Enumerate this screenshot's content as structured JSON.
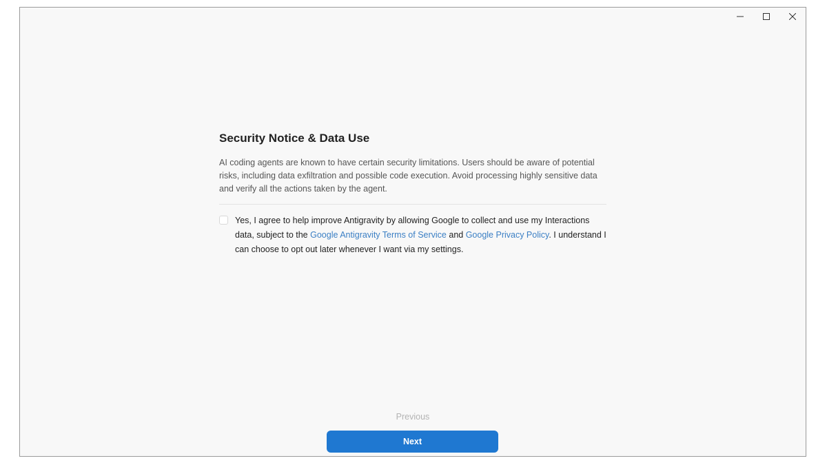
{
  "window": {
    "controls": {
      "minimize_icon": "minimize-icon",
      "maximize_icon": "maximize-icon",
      "close_icon": "close-icon"
    }
  },
  "notice": {
    "title": "Security Notice & Data Use",
    "body": "AI coding agents are known to have certain security limitations. Users should be aware of potential risks, including data exfiltration and possible code execution. Avoid processing highly sensitive data and verify all the actions taken by the agent."
  },
  "consent": {
    "checked": false,
    "text_part1": "Yes, I agree to help improve Antigravity by allowing Google to collect and use my Interactions data, subject to the ",
    "terms_link": "Google Antigravity Terms of Service",
    "text_part2": " and ",
    "privacy_link": "Google Privacy Policy",
    "text_part3": ". I understand I can choose to opt out later whenever I want via my settings."
  },
  "navigation": {
    "previous_label": "Previous",
    "next_label": "Next"
  },
  "colors": {
    "accent": "#1f78d1",
    "link": "#3b7fc4",
    "background": "#f8f8f8"
  }
}
